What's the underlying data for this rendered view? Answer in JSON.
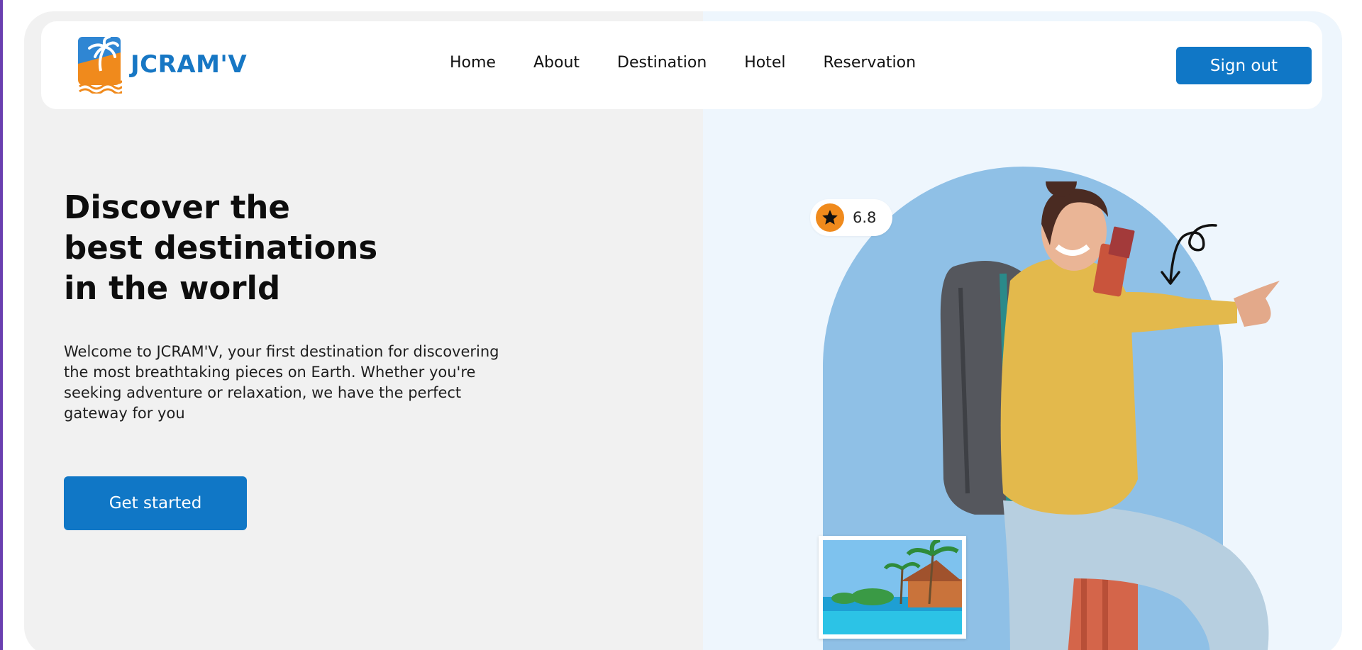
{
  "brand": {
    "name": "JCRAM'V",
    "color": "#1777c4",
    "accent": "#f08a1c"
  },
  "nav": {
    "links": [
      "Home",
      "About",
      "Destination",
      "Hotel",
      "Reservation"
    ],
    "signout_label": "Sign out"
  },
  "hero": {
    "title_lines": [
      "Discover the",
      "best destinations",
      "in the world"
    ],
    "description": "Welcome to JCRAM'V, your first destination for discovering the most breathtaking pieces on Earth. Whether you're seeking adventure or relaxation, we have the perfect gateway for you",
    "cta_label": "Get started"
  },
  "rating": {
    "icon": "star-icon",
    "value": "6.8"
  },
  "colors": {
    "primary_button": "#1077c6",
    "left_panel": "#f1f1f1",
    "right_panel": "#eef6fd",
    "arch": "#8fc0e6"
  }
}
